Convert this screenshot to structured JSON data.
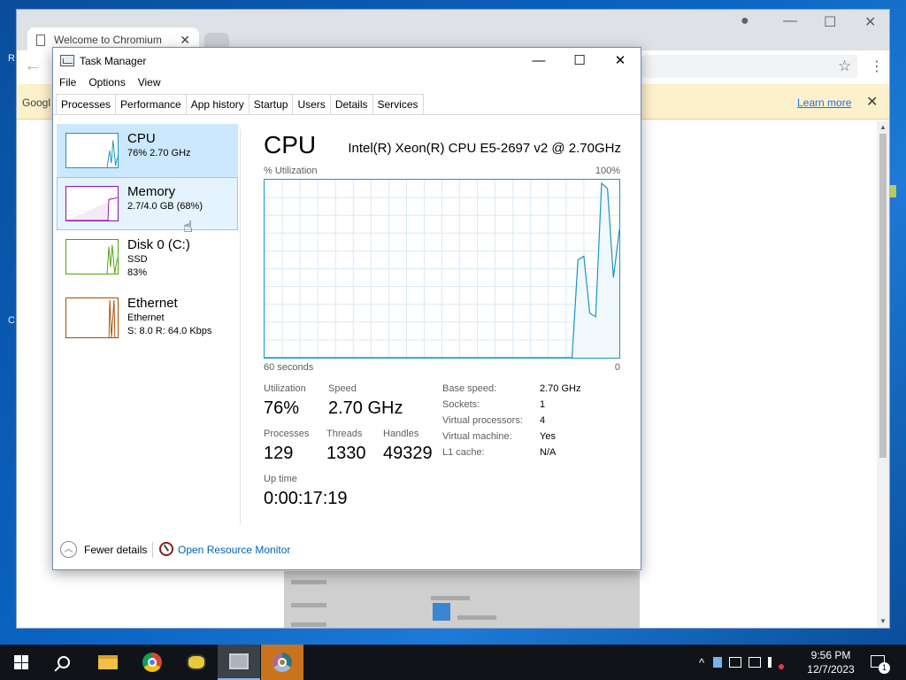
{
  "desktop": {
    "glyphs": [
      "R",
      "C"
    ]
  },
  "browser": {
    "tab_title": "Welcome to Chromium",
    "tab_close": "✕",
    "infobar_text": "Googl",
    "infobar_link": "Learn more",
    "infobar_close": "✕",
    "back_arrow": "←",
    "star": "☆",
    "kebab": "⋮",
    "profile": "●",
    "minimize": "—",
    "maximize": "☐",
    "close": "✕"
  },
  "task_manager": {
    "title": "Task Manager",
    "window_controls": {
      "minimize": "—",
      "maximize": "☐",
      "close": "✕"
    },
    "menu": [
      "File",
      "Options",
      "View"
    ],
    "tabs": [
      "Processes",
      "Performance",
      "App history",
      "Startup",
      "Users",
      "Details",
      "Services"
    ],
    "active_tab": "Performance",
    "sidebar": [
      {
        "title": "CPU",
        "sub1": "76% 2.70 GHz",
        "sub2": "",
        "state": "selected",
        "color": "#1795c8"
      },
      {
        "title": "Memory",
        "sub1": "2.7/4.0 GB (68%)",
        "sub2": "",
        "state": "hover",
        "color": "#8b12ae"
      },
      {
        "title": "Disk 0 (C:)",
        "sub1": "SSD",
        "sub2": "83%",
        "state": "",
        "color": "#4da60c"
      },
      {
        "title": "Ethernet",
        "sub1": "Ethernet",
        "sub2": "S: 8.0  R: 64.0 Kbps",
        "state": "",
        "color": "#a74f01"
      }
    ],
    "main": {
      "title": "CPU",
      "model": "Intel(R) Xeon(R) CPU E5-2697 v2 @ 2.70GHz",
      "graph_label_left": "% Utilization",
      "graph_label_right": "100%",
      "graph_bottom_left": "60 seconds",
      "graph_bottom_right": "0",
      "utilization_history_pct": [
        0,
        0,
        0,
        0,
        0,
        0,
        0,
        0,
        0,
        0,
        0,
        0,
        0,
        0,
        0,
        0,
        0,
        0,
        0,
        0,
        0,
        0,
        0,
        0,
        0,
        0,
        0,
        0,
        0,
        0,
        0,
        0,
        0,
        0,
        0,
        0,
        0,
        0,
        0,
        0,
        0,
        0,
        0,
        0,
        0,
        0,
        0,
        0,
        0,
        0,
        0,
        0,
        0,
        55,
        57,
        25,
        23,
        98,
        95,
        45,
        72
      ],
      "stats": {
        "utilization_label": "Utilization",
        "utilization": "76%",
        "speed_label": "Speed",
        "speed": "2.70 GHz",
        "processes_label": "Processes",
        "processes": "129",
        "threads_label": "Threads",
        "threads": "1330",
        "handles_label": "Handles",
        "handles": "49329",
        "uptime_label": "Up time",
        "uptime": "0:00:17:19"
      },
      "details": [
        {
          "k": "Base speed:",
          "v": "2.70 GHz"
        },
        {
          "k": "Sockets:",
          "v": "1"
        },
        {
          "k": "Virtual processors:",
          "v": "4"
        },
        {
          "k": "Virtual machine:",
          "v": "Yes"
        },
        {
          "k": "L1 cache:",
          "v": "N/A"
        }
      ]
    },
    "footer": {
      "fewer_details": "Fewer details",
      "open_resource_monitor": "Open Resource Monitor"
    }
  },
  "taskbar": {
    "clock_time": "9:56 PM",
    "clock_date": "12/7/2023",
    "notif_count": "1",
    "tray_chevron": "^"
  },
  "colors": {
    "cpu": "#1795c8",
    "memory": "#8b12ae",
    "disk": "#4da60c",
    "ethernet": "#a74f01",
    "link": "#0063b1"
  }
}
